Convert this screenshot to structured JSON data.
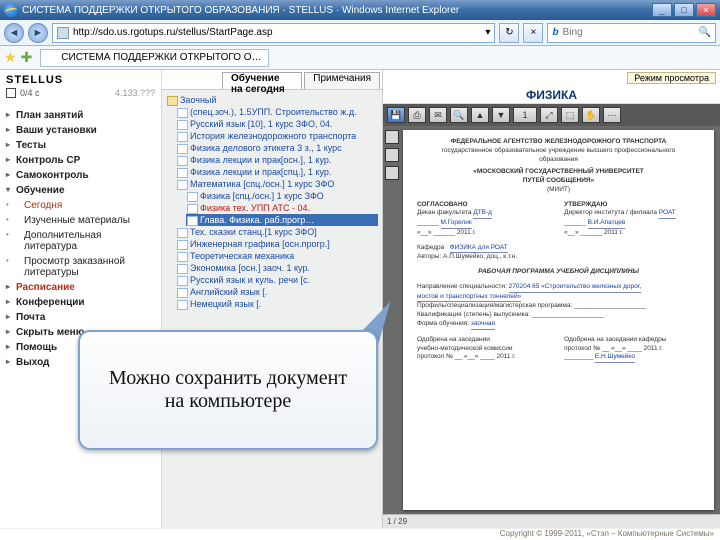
{
  "window": {
    "title": "СИСТЕМА ПОДДЕРЖКИ ОТКРЫТОГО ОБРАЗОВАНИЯ · STELLUS · Windows Internet Explorer",
    "min": "_",
    "max": "□",
    "close": "×"
  },
  "nav": {
    "back": "◄",
    "fwd": "►",
    "url": "http://sdo.us.rgotups.ru/stellus/StartPage.asp",
    "refresh": "↻",
    "stop": "×",
    "search_engine": "Bing",
    "search_q": ""
  },
  "favbar": {
    "star": "★",
    "plus": "✚",
    "tab": "СИСТЕМА ПОДДЕРЖКИ ОТКРЫТОГО О…"
  },
  "sidebar": {
    "brand": "STELLUS",
    "ver": "4.133.???",
    "u": "0/4 с",
    "items": [
      {
        "label": "План занятий",
        "bold": true
      },
      {
        "label": "Ваши установки",
        "bold": true
      },
      {
        "label": "Тесты",
        "bold": true
      },
      {
        "label": "Контроль СР",
        "bold": true
      },
      {
        "label": "Самоконтроль",
        "bold": true
      },
      {
        "label": "Обучение",
        "bold": true,
        "open": true,
        "hl": false
      },
      {
        "label": "Сегодня",
        "sub": true,
        "hl": true
      },
      {
        "label": "Изученные материалы",
        "sub": true
      },
      {
        "label": "Дополнительная литература",
        "sub": true
      },
      {
        "label": "Просмотр заказанной литературы",
        "sub": true
      },
      {
        "label": "Расписание",
        "bold": true,
        "hl": true
      },
      {
        "label": "Конференции",
        "bold": true
      },
      {
        "label": "Почта",
        "bold": true
      },
      {
        "label": "Скрыть меню",
        "bold": true
      },
      {
        "label": "Помощь",
        "bold": true
      },
      {
        "label": "Выход",
        "bold": true
      }
    ]
  },
  "center": {
    "tab_main": "Обучение на сегодня",
    "tab_note": "Примечания",
    "root": "Заочный",
    "tree": [
      "(спец.зоч.), 1.5УПП. Строительство ж.д.",
      "Русский язык [10], 1 курс ЗФО, 04.",
      "История железнодорожного транспорта",
      "Физика делового этикета 3 з., 1 курс",
      "Физика лекции и прак[осн.], 1 кур.",
      "Физика лекции и прак[спц.], 1 кур.",
      "Математика [спц./осн.] 1 курс ЗФО",
      "Физика [спц./осн.] 1 курс ЗФО",
      "Физика тех. УПП АТС - 04.",
      "Глава. Физика. раб.прогр…",
      "Тех. сказки станц.[1 курс ЗФО]",
      "Инженерная графика [осн.прогр.]",
      "Теоретическая механика",
      "Экономика [осн.] заоч. 1 кур.",
      "Русский язык и куль. речи [с.",
      "Английский язык [.",
      "Немецкий язык [."
    ],
    "tree_red_idx": 8,
    "tree_sel_idx": 9
  },
  "right": {
    "mode": "Режим просмотра",
    "heading": "ФИЗИКА",
    "pdf_toolbar": {
      "save": "💾",
      "print": "⎙",
      "mail": "✉",
      "find": "🔍",
      "up": "▲",
      "down": "▼",
      "zoom": "⤢",
      "page": "1",
      "fit": "⬚",
      "hand": "✋"
    },
    "status": {
      "page": "1 / 29",
      "size": "—"
    }
  },
  "doc": {
    "l1": "ФЕДЕРАЛЬНОЕ АГЕНТСТВО ЖЕЛЕЗНОДОРОЖНОГО ТРАНСПОРТА",
    "l2": "государственное образовательное учреждение высшего профессионального",
    "l3": "образования",
    "l4": "«МОСКОВСКИЙ ГОСУДАРСТВЕННЫЙ УНИВЕРСИТЕТ",
    "l5": "ПУТЕЙ СООБЩЕНИЯ»",
    "l6": "(МИИТ)",
    "left_h": "СОГЛАСОВАНО",
    "right_h": "УТВЕРЖДАЮ",
    "left_1": "Декан факультета",
    "right_1": "Директор института / филиала",
    "left_2": "ДТВ-д",
    "right_2": "РОАТ",
    "left_3": "М.Горелик",
    "right_3": "В.И.Апатцев",
    "year": "2011 г.",
    "kaf": "Кафедра",
    "kaf_v": "ФИЗИКА для РОАТ",
    "auth": "Авторы: А.П.Шумейко, доц., к.т.н.",
    "title": "РАБОЧАЯ ПРОГРАММА УЧЕБНОЙ ДИСЦИПЛИНЫ",
    "spec_l": "Направление специальности:",
    "spec_v": "270204.65 «Строительство железных дорог,",
    "spec_v2": "мостов и транспортных тоннелей»",
    "prof_l": "Профиль/специализация/магистерская программа:",
    "kval_l": "Квалификация (степень) выпускника:",
    "form_l": "Форма обучения:",
    "form_v": "заочная",
    "appr_l1": "Одобрена на заседании",
    "appr_l2": "учебно-методической комиссии",
    "appr_l3": "протокол №",
    "appr_r1": "Одобрена на заседании кафедры",
    "appr_r3": "протокол №",
    "year2": "2011 г.",
    "sign_r": "Е.Н.Шумейко"
  },
  "callout": {
    "text1": "Можно сохранить документ",
    "text2": "на компьютере"
  },
  "footer": "Copyright © 1999-2011, «Стэл – Компьютерные Системы»"
}
